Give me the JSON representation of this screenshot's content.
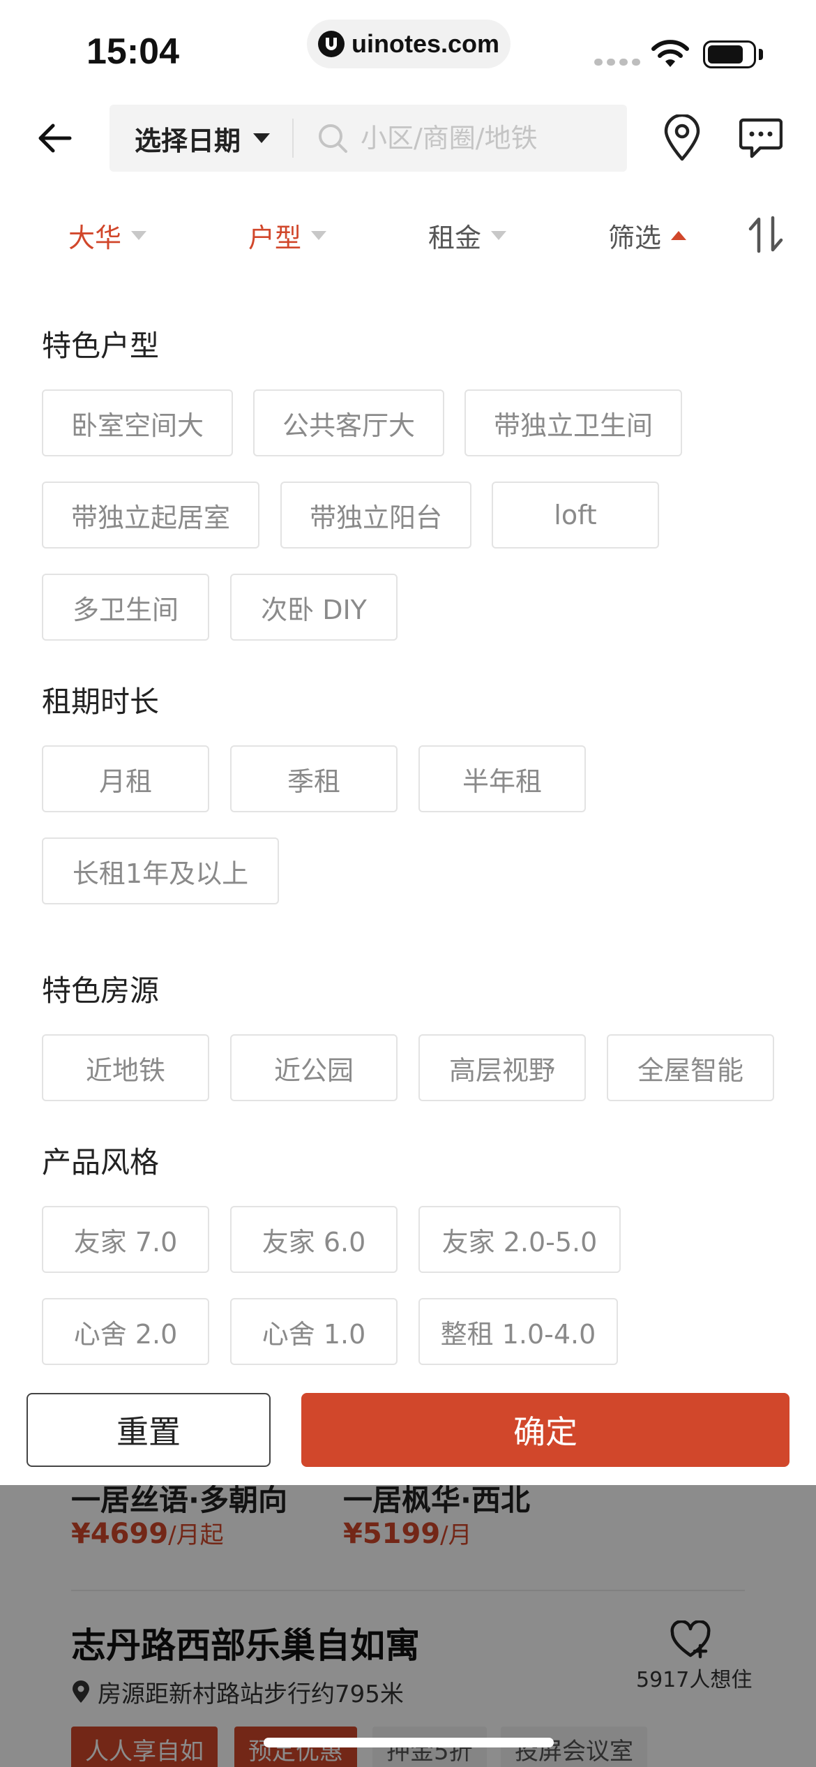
{
  "status_bar": {
    "time": "15:04",
    "url": "uinotes.com"
  },
  "header": {
    "date_select": "选择日期",
    "search_placeholder": "小区/商圈/地铁"
  },
  "filter_tabs": [
    {
      "label": "大华",
      "active": true
    },
    {
      "label": "户型",
      "active": true
    },
    {
      "label": "租金",
      "active": false
    },
    {
      "label": "筛选",
      "active": false,
      "open": true
    }
  ],
  "sections": [
    {
      "title": "特色户型",
      "tags": [
        "卧室空间大",
        "公共客厅大",
        "带独立卫生间",
        "带独立起居室",
        "带独立阳台",
        "loft",
        "多卫生间",
        "次卧 DIY"
      ]
    },
    {
      "title": "租期时长",
      "tags": [
        "月租",
        "季租",
        "半年租",
        "长租1年及以上"
      ]
    },
    {
      "title": "特色房源",
      "tags": [
        "近地铁",
        "近公园",
        "高层视野",
        "全屋智能"
      ]
    },
    {
      "title": "产品风格",
      "tags": [
        "友家 7.0",
        "友家 6.0",
        "友家 2.0-5.0",
        "心舍 2.0",
        "心舍 1.0",
        "整租 1.0-4.0"
      ]
    }
  ],
  "actions": {
    "reset": "重置",
    "confirm": "确定"
  },
  "listing": {
    "sub_items": [
      {
        "name": "一居丝语·多朝向",
        "price": "¥4699",
        "unit": "/月起"
      },
      {
        "name": "一居枫华·西北",
        "price": "¥5199",
        "unit": "/月"
      }
    ],
    "title": "志丹路西部乐巢自如寓",
    "distance": "房源距新村路站步行约795米",
    "want_count": "5917人想住",
    "tags": [
      "人人享自如",
      "预定优惠",
      "押金5折",
      "投屏会议室"
    ]
  },
  "colors": {
    "accent": "#d1472b",
    "tag_border": "#e3e3e3",
    "tag_text": "#8a8a8a"
  }
}
